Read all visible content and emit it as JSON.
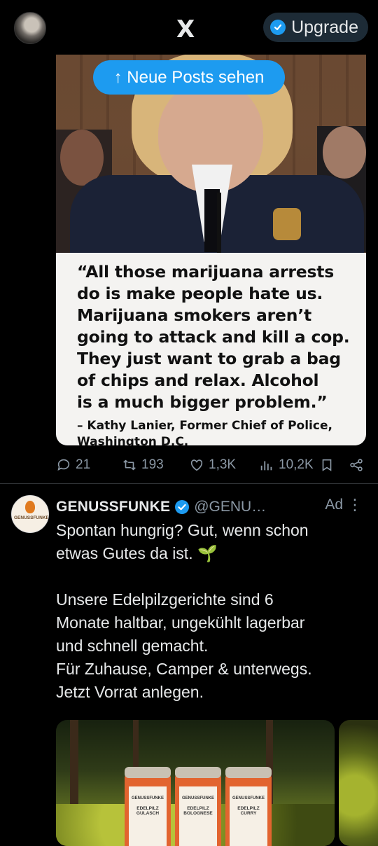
{
  "top_bar": {
    "logo": "X",
    "upgrade_label": "Upgrade"
  },
  "new_posts_pill": "↑ Neue Posts sehen",
  "post1": {
    "quote": "“All those marijuana arrests\ndo is make people hate us.\nMarijuana smokers aren’t\ngoing to attack and kill a cop.\nThey just want to grab a bag\nof chips and relax. Alcohol\nis a much bigger problem.”",
    "attribution": "– Kathy Lanier, Former Chief of Police,\nWashington D.C.",
    "replies": "21",
    "reposts": "193",
    "likes": "1,3K",
    "views": "10,2K"
  },
  "ad_post": {
    "avatar_text": "GENUSSFUNKE",
    "name": "GENUSSFUNKE",
    "handle": "@GENU…",
    "ad_label": "Ad",
    "more": "⋮",
    "text": "Spontan hungrig? Gut, wenn schon\netwas Gutes da ist. 🌱\n\nUnsere Edelpilzgerichte sind 6\nMonate haltbar, ungekühlt lagerbar\nund schnell gemacht.\nFür Zuhause, Camper & unterwegs.\nJetzt Vorrat anlegen.",
    "jars": [
      {
        "brand": "GENUSSFUNKE",
        "line1": "EDELPILZ",
        "line2": "GULASCH"
      },
      {
        "brand": "GENUSSFUNKE",
        "line1": "EDELPILZ",
        "line2": "BOLOGNESE"
      },
      {
        "brand": "GENUSSFUNKE",
        "line1": "EDELPILZ",
        "line2": "CURRY"
      }
    ]
  },
  "colors": {
    "background": "#000000",
    "accent": "#1d9bf0",
    "muted_text": "#8b98a5",
    "primary_text": "#e7e9ea"
  },
  "icons": [
    "x-logo-icon",
    "verified-badge-icon",
    "reply-icon",
    "repost-icon",
    "like-icon",
    "views-icon",
    "bookmark-icon",
    "share-icon",
    "more-icon"
  ]
}
